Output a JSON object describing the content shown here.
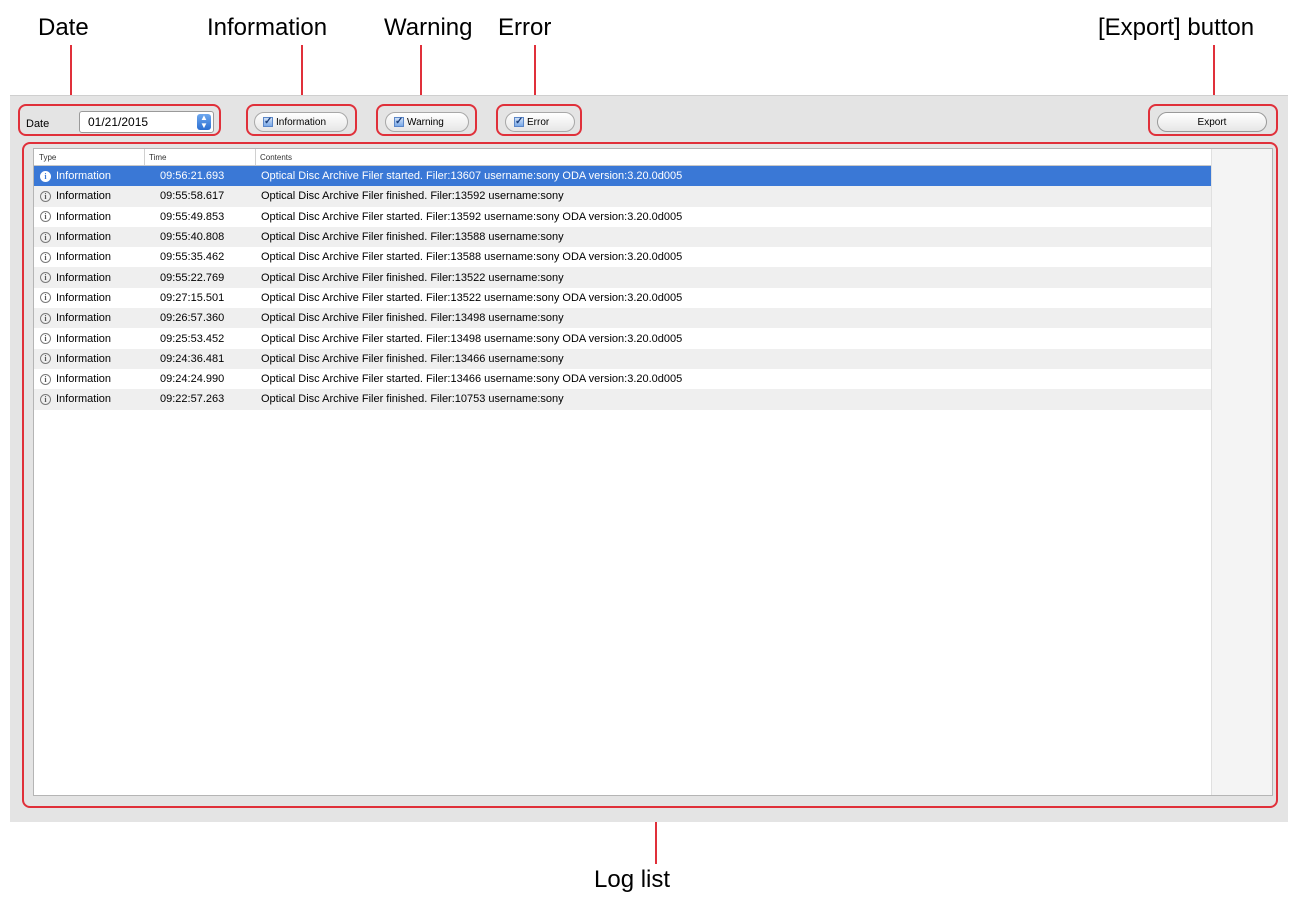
{
  "callouts": {
    "date": "Date",
    "information": "Information",
    "warning": "Warning",
    "error": "Error",
    "export": "[Export] button",
    "log_list": "Log list"
  },
  "toolbar": {
    "date_label": "Date",
    "date_value": "01/21/2015",
    "information_label": "Information",
    "warning_label": "Warning",
    "error_label": "Error",
    "export_label": "Export"
  },
  "log_list": {
    "columns": [
      "Type",
      "Time",
      "Contents"
    ],
    "rows": [
      {
        "type": "Information",
        "time": "09:56:21.693",
        "contents": "Optical Disc Archive Filer started. Filer:13607 username:sony ODA version:3.20.0d005",
        "selected": true
      },
      {
        "type": "Information",
        "time": "09:55:58.617",
        "contents": "Optical Disc Archive Filer finished. Filer:13592 username:sony"
      },
      {
        "type": "Information",
        "time": "09:55:49.853",
        "contents": "Optical Disc Archive Filer started. Filer:13592 username:sony ODA version:3.20.0d005"
      },
      {
        "type": "Information",
        "time": "09:55:40.808",
        "contents": "Optical Disc Archive Filer finished. Filer:13588 username:sony"
      },
      {
        "type": "Information",
        "time": "09:55:35.462",
        "contents": "Optical Disc Archive Filer started. Filer:13588 username:sony ODA version:3.20.0d005"
      },
      {
        "type": "Information",
        "time": "09:55:22.769",
        "contents": "Optical Disc Archive Filer finished. Filer:13522 username:sony"
      },
      {
        "type": "Information",
        "time": "09:27:15.501",
        "contents": "Optical Disc Archive Filer started. Filer:13522 username:sony ODA version:3.20.0d005"
      },
      {
        "type": "Information",
        "time": "09:26:57.360",
        "contents": "Optical Disc Archive Filer finished. Filer:13498 username:sony"
      },
      {
        "type": "Information",
        "time": "09:25:53.452",
        "contents": "Optical Disc Archive Filer started. Filer:13498 username:sony ODA version:3.20.0d005"
      },
      {
        "type": "Information",
        "time": "09:24:36.481",
        "contents": "Optical Disc Archive Filer finished. Filer:13466 username:sony"
      },
      {
        "type": "Information",
        "time": "09:24:24.990",
        "contents": "Optical Disc Archive Filer started. Filer:13466 username:sony ODA version:3.20.0d005"
      },
      {
        "type": "Information",
        "time": "09:22:57.263",
        "contents": "Optical Disc Archive Filer finished. Filer:10753 username:sony"
      }
    ]
  },
  "colors": {
    "callout_red": "#e0303a",
    "selection_blue": "#3a78d6"
  },
  "icons": {
    "row_icon": "info-circle-icon",
    "checkbox": "checkmark-icon",
    "stepper": "stepper-arrows-icon"
  }
}
